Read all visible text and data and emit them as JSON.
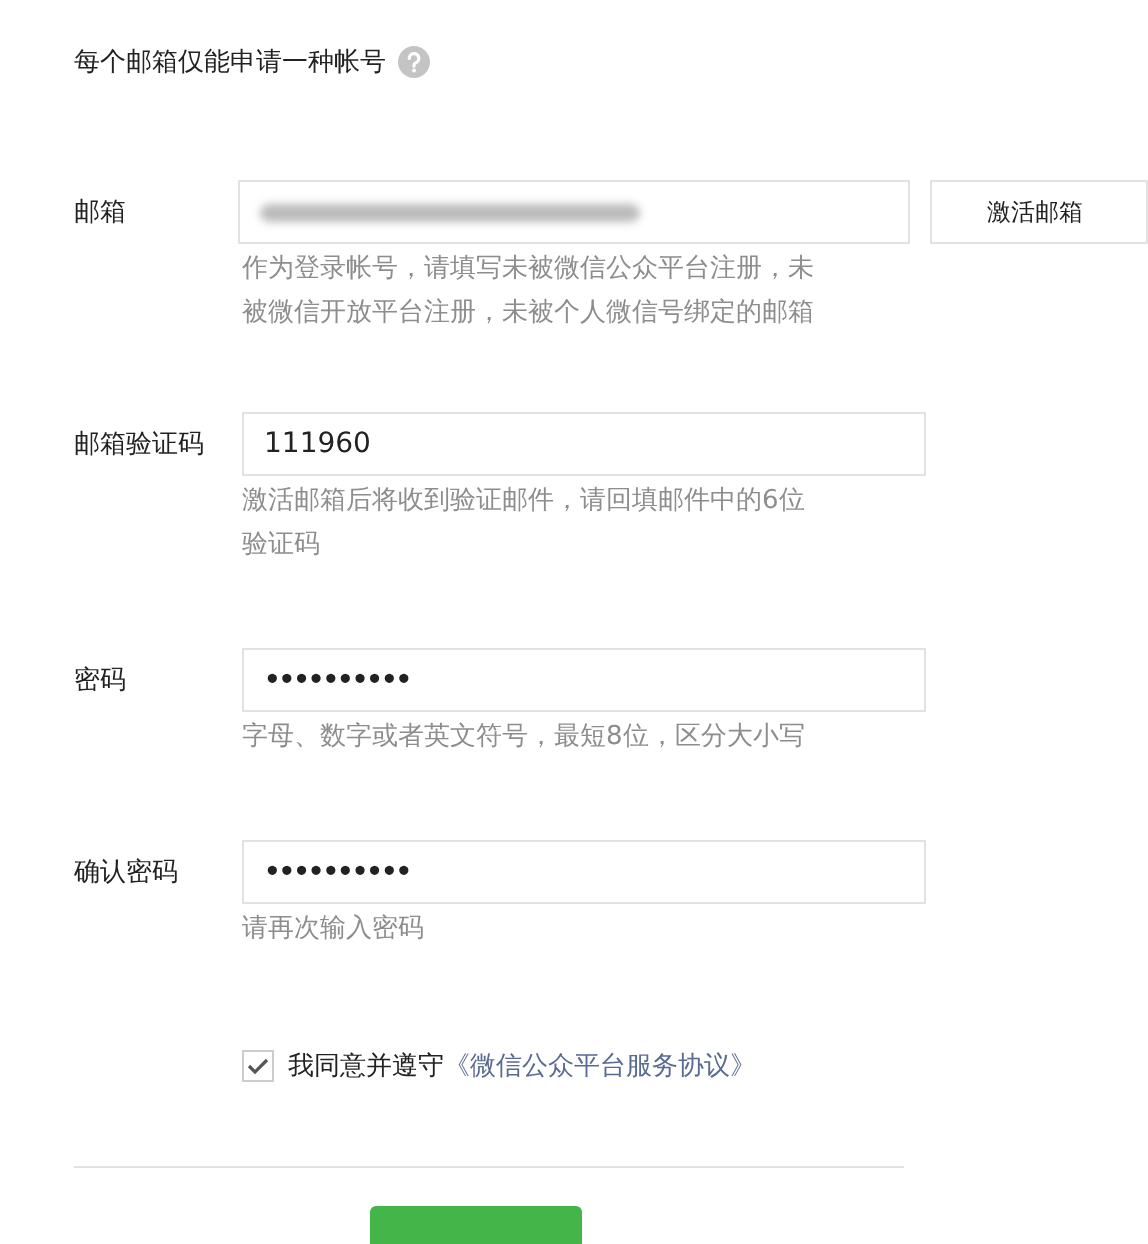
{
  "notice": {
    "text": "每个邮箱仅能申请一种帐号"
  },
  "fields": [
    {
      "label": "邮箱",
      "kind": "email",
      "value_blurred": true,
      "button": "激活邮箱",
      "hint": "作为登录帐号，请填写未被微信公众平台注册，未被微信开放平台注册，未被个人微信号绑定的邮箱"
    },
    {
      "label": "邮箱验证码",
      "kind": "text",
      "value": "111960",
      "hint": "激活邮箱后将收到验证邮件，请回填邮件中的6位验证码"
    },
    {
      "label": "密码",
      "kind": "password",
      "value": "••••••••••",
      "hint": "字母、数字或者英文符号，最短8位，区分大小写"
    },
    {
      "label": "确认密码",
      "kind": "password",
      "value": "••••••••••",
      "hint": "请再次输入密码"
    }
  ],
  "agreement": {
    "checked": true,
    "text": "我同意并遵守",
    "link": "《微信公众平台服务协议》"
  }
}
